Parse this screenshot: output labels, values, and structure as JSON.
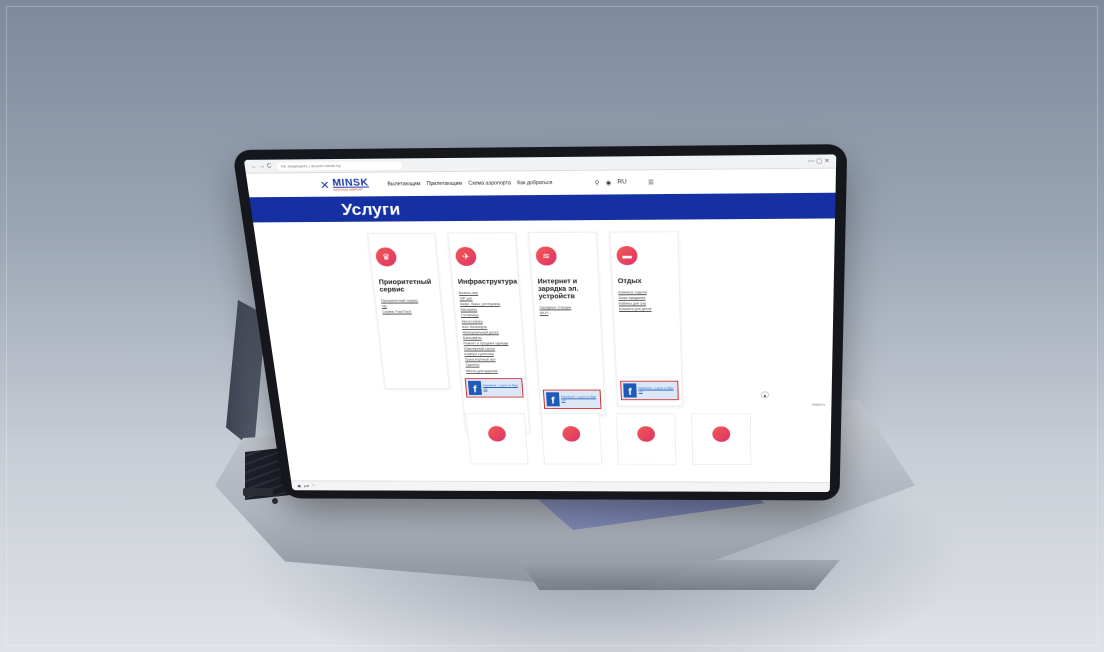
{
  "browser": {
    "nav_glyphs": "← → C",
    "url": "Не защищено | airport-minsk.by"
  },
  "header": {
    "logo_mark": "✕",
    "logo_name": "MINSK",
    "logo_sub": "NATIONAL AIRPORT",
    "menu": [
      "Вылетающим",
      "Прилетающим",
      "Схема аэропорта",
      "Как добраться"
    ],
    "tools": {
      "search_icon": "search-icon",
      "globe_icon": "globe-icon",
      "lang": "RU",
      "menu_icon": "hamburger-icon"
    }
  },
  "hero": {
    "title": "Услуги"
  },
  "cards": [
    {
      "icon": "♛",
      "title": "Приоритетный сервис",
      "links": [
        "Приоритетный сервис",
        "Vip",
        "Сервис FastTrack"
      ]
    },
    {
      "icon": "✈",
      "title": "Инфраструктура",
      "links": [
        "Бизнес-зал",
        "VIP-зал",
        "Кафе, бары, рестораны",
        "Магазины",
        "Гостиница",
        "Автостоянка",
        "АЗС Белнефть",
        "Мемориальная доска",
        "Банкоматы",
        "Ремонт и продажа одежды",
        "Ювелирный салон",
        "Камера хранения",
        "Транспортный зал",
        "Туалеты",
        "Место для курения"
      ],
      "fb": true
    },
    {
      "icon": "≋",
      "title": "Интернет и зарядка эл. устройств",
      "links": [
        "Зарядные станции",
        "Wi-Fi"
      ],
      "fb": true
    },
    {
      "icon": "▬",
      "title": "Отдых",
      "links": [
        "Комнаты отдыха",
        "Зоны ожидания",
        "Кабины для сна",
        "Комната для детей"
      ],
      "fb": true
    }
  ],
  "facebook": {
    "logo": "f",
    "text": "Facebook – Log in or Sign Up"
  },
  "scroll_glyph": "▲",
  "cookie_text": "Закрыть",
  "download": {
    "file_icon": "file-icon",
    "file_name": "pdf",
    "chevron": "⌃"
  },
  "colors": {
    "brand_blue": "#1530a3",
    "accent_gradient_start": "#ef5d4f",
    "accent_gradient_end": "#e0306b",
    "facebook_blue": "#1e5bb8"
  }
}
